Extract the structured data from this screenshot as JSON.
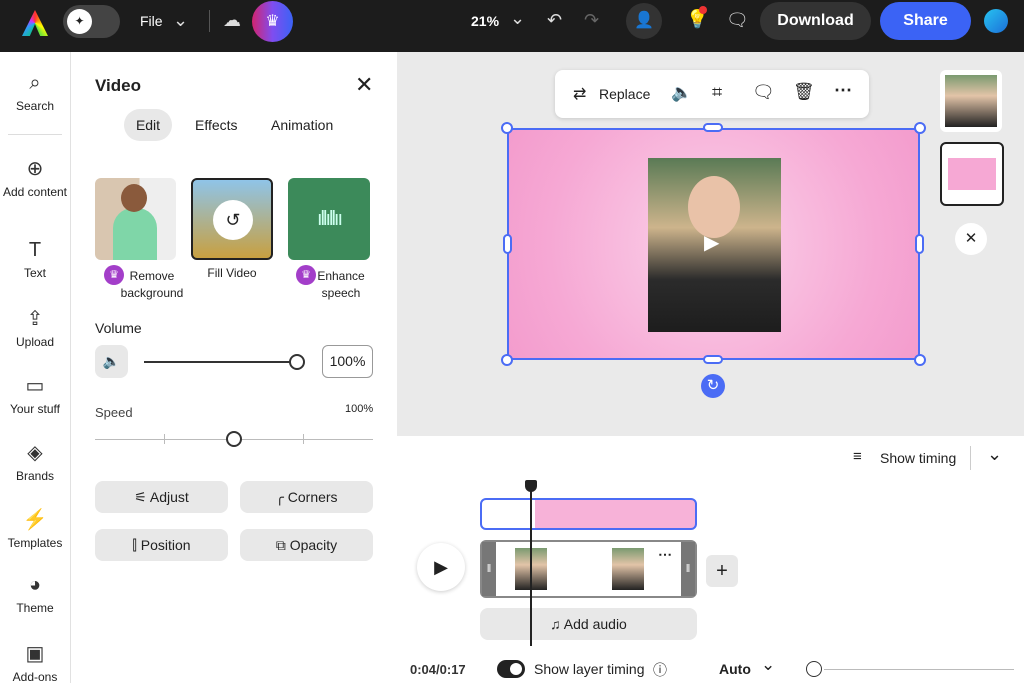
{
  "topbar": {
    "file_label": "File",
    "zoom": "21%",
    "download_label": "Download",
    "share_label": "Share"
  },
  "rail": [
    {
      "label": "Search",
      "icon": "⌕"
    },
    {
      "label": "Add content",
      "icon": "⊕"
    },
    {
      "label": "Text",
      "icon": "T"
    },
    {
      "label": "Upload",
      "icon": "⇪"
    },
    {
      "label": "Your stuff",
      "icon": "▭"
    },
    {
      "label": "Brands",
      "icon": "◈"
    },
    {
      "label": "Templates",
      "icon": "⚡"
    },
    {
      "label": "Theme",
      "icon": "◕"
    },
    {
      "label": "Add-ons",
      "icon": "▣"
    }
  ],
  "panel": {
    "title": "Video",
    "tabs": [
      "Edit",
      "Effects",
      "Animation"
    ],
    "tools": [
      {
        "label": "Remove background"
      },
      {
        "label": "Fill Video"
      },
      {
        "label": "Enhance speech"
      }
    ],
    "volume_label": "Volume",
    "volume_value": "100%",
    "volume_fraction": 1.0,
    "speed_label": "Speed",
    "speed_value": "100%",
    "speed_fraction": 0.5,
    "buttons": [
      "Adjust",
      "Corners",
      "Position",
      "Opacity"
    ]
  },
  "canvas": {
    "toolbar": {
      "replace_label": "Replace"
    }
  },
  "timeline": {
    "show_timing_label": "Show timing",
    "add_audio_label": "Add audio",
    "time": "0:04/0:17",
    "layer_timing_label": "Show layer timing",
    "auto_label": "Auto"
  }
}
